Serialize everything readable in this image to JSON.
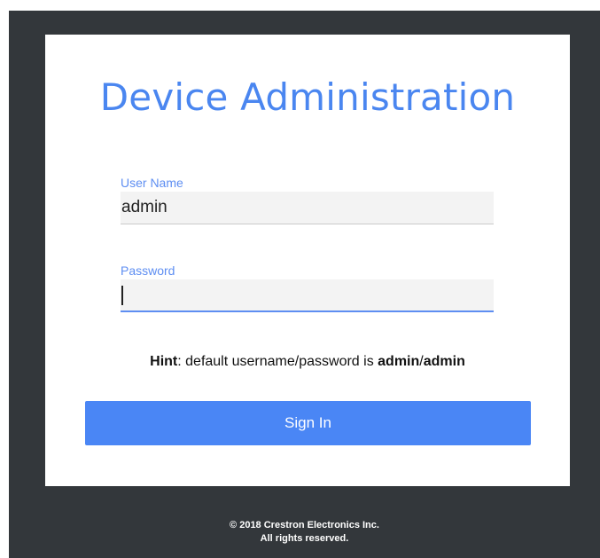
{
  "login": {
    "title": "Device Administration",
    "username": {
      "label": "User Name",
      "value": "admin"
    },
    "password": {
      "label": "Password",
      "value": ""
    },
    "hint": {
      "prefix": "Hint",
      "middle": ": default username/password is ",
      "user": "admin",
      "separator": "/",
      "pass": "admin"
    },
    "sign_in_label": "Sign In"
  },
  "footer": {
    "copyright": "© 2018 Crestron Electronics Inc.",
    "rights": "All rights reserved."
  },
  "colors": {
    "background": "#33373b",
    "accent": "#4a86f5",
    "label": "#5e8ef2"
  }
}
